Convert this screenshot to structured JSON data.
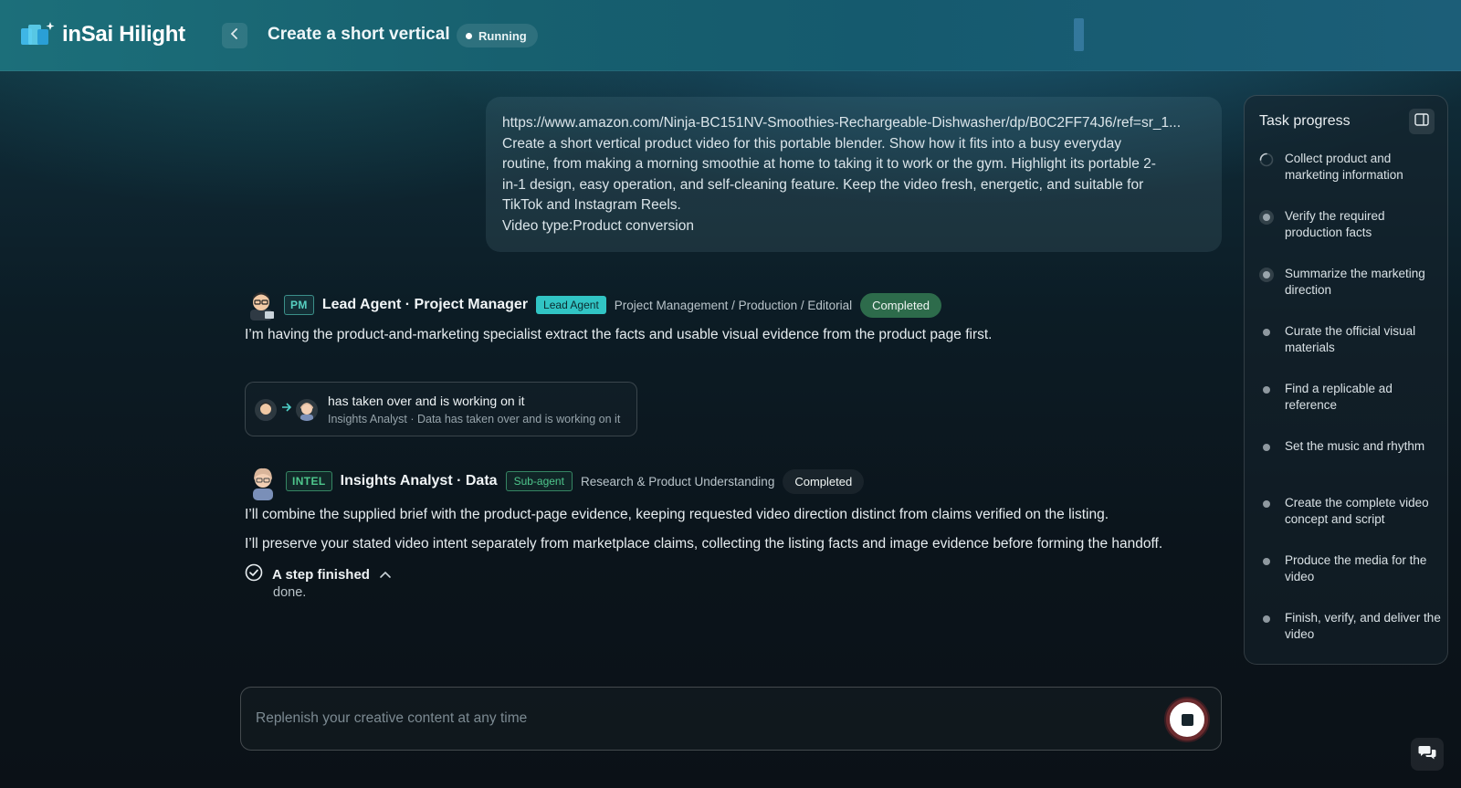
{
  "app": {
    "name": "inSai Hilight"
  },
  "header": {
    "title": "Create a short vertical",
    "status": "Running"
  },
  "user_message": {
    "url": "https://www.amazon.com/Ninja-BC151NV-Smoothies-Rechargeable-Dishwasher/dp/B0C2FF74J6/ref=sr_1...",
    "lines": [
      "Create a short vertical product video for this portable blender. Show how it fits into a busy everyday",
      "routine, from making a morning smoothie at home to taking it to work or the gym. Highlight its portable 2-",
      "in-1 design, easy operation, and self-cleaning feature. Keep the video fresh, energetic, and suitable for",
      "TikTok and Instagram Reels."
    ],
    "video_type": "Video type:Product conversion"
  },
  "lead_agent": {
    "code": "PM",
    "name": "Lead Agent · Project Manager",
    "role": "Lead Agent",
    "department": "Project Management / Production / Editorial",
    "status": "Completed",
    "message": "I’m having the product-and-marketing specialist extract the facts and usable visual evidence from the product page first."
  },
  "handoff": {
    "title": "has taken over and is working on it",
    "subtitle": "Insights Analyst · Data has taken over and is working on it"
  },
  "insights_agent": {
    "code": "INTEL",
    "name": "Insights Analyst · Data",
    "role": "Sub-agent",
    "department": "Research & Product Understanding",
    "status": "Completed",
    "messages": [
      "I’ll combine the supplied brief with the product-page evidence, keeping requested video direction distinct from claims verified on the listing.",
      "I’ll preserve your stated video intent separately from marketplace claims, collecting the listing facts and image evidence before forming the handoff."
    ],
    "step_label": "A step finished",
    "step_detail": "done."
  },
  "composer": {
    "placeholder": "Replenish your creative content at any time"
  },
  "task_panel": {
    "title": "Task progress",
    "items": [
      {
        "label": "Collect product and marketing information",
        "state": "in-progress"
      },
      {
        "label": "Verify the required production facts",
        "state": "pending-ring"
      },
      {
        "label": "Summarize the marketing direction",
        "state": "pending-ring"
      },
      {
        "label": "Curate the official visual materials",
        "state": "pending"
      },
      {
        "label": "Find a replicable ad reference",
        "state": "pending"
      },
      {
        "label": "Set the music and rhythm",
        "state": "pending"
      },
      {
        "label": "Create the complete video concept and script",
        "state": "pending"
      },
      {
        "label": "Produce the media for the video",
        "state": "pending"
      },
      {
        "label": "Finish, verify, and deliver the video",
        "state": "pending"
      }
    ]
  },
  "colors": {
    "accent_teal": "#31c4c4",
    "completed_green": "#2d6b4b",
    "stop_ring": "#6b2b2e"
  }
}
